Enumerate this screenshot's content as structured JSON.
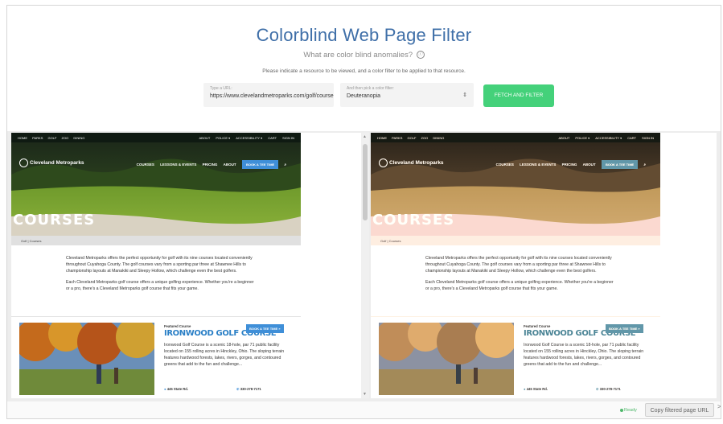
{
  "app": {
    "title": "Colorblind Web Page Filter",
    "subtitle": "What are color blind anomalies?",
    "info_icon": "ⓘ",
    "instruction": "Please indicate a resource to be viewed, and a color filter to be applied to that resource."
  },
  "url_field": {
    "label": "Type a URL:",
    "value": "https://www.clevelandmetroparks.com/golf/course"
  },
  "filter_field": {
    "label": "And then pick a color filter:",
    "value": "Deuteranopia"
  },
  "fetch_button": {
    "label": "FETCH AND FILTER"
  },
  "site": {
    "topnav_left": [
      "HOME",
      "PARKS",
      "GOLF",
      "ZOO",
      "DINING"
    ],
    "topnav_right": [
      "ABOUT",
      "POLICE ▾",
      "ACCESSIBILITY ▾",
      "CART",
      "SIGN IN"
    ],
    "logo_text": "Cleveland Metroparks",
    "mainnav": [
      "COURSES",
      "LESSONS & EVENTS",
      "PRICING",
      "ABOUT"
    ],
    "tee_button": "BOOK A TEE TIME",
    "hero_heading": "COURSES",
    "breadcrumb": "Golf | Courses",
    "intro_p1": "Cleveland Metroparks offers the perfect opportunity for golf with its nine courses located conveniently throughout Cuyahoga County. The golf courses vary from a sporting par three at Shawnee Hills to championship layouts at Manakiki and Sleepy Hollow, which challenge even the best golfers.",
    "intro_p2": "Each Cleveland Metroparks golf course offers a unique golfing experience. Whether you're a beginner or a pro, there's a Cleveland Metroparks golf course that fits your game.",
    "featured_label": "Featured Course",
    "featured_title": "IRONWOOD GOLF COURSE",
    "featured_button": "BOOK A TEE TIME »",
    "featured_desc": "Ironwood Golf Course is a scenic 18-hole, par 71 public facility located on 155 rolling acres in Hinckley, Ohio. The sloping terrain features hardwood forests, lakes, rivers, gorges, and contoured greens that add to the fun and challenge...",
    "featured_location": "445 State Rd.",
    "featured_phone": "330-278-7171"
  },
  "status": {
    "text": "Ready"
  },
  "copy_button": {
    "label": "Copy filtered page URL"
  },
  "expand_button": {
    "label": ">"
  },
  "colors": {
    "title": "#3f6fa8",
    "fetch_button": "#44d17a",
    "link_blue": "#2a7fc6",
    "status_green": "#4fb86b"
  }
}
